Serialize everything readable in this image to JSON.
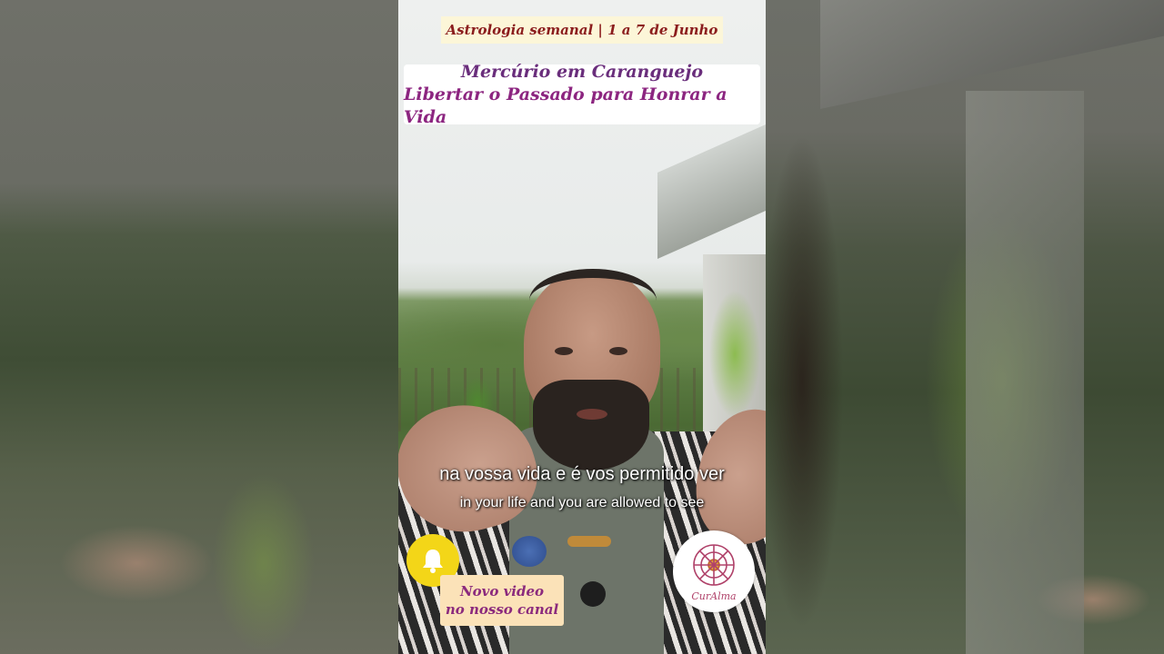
{
  "video": {
    "header_tag": "Astrologia semanal | 1 a 7 de Junho",
    "title_line1": "Mercúrio em Caranguejo",
    "title_line2": "Libertar o Passado para Honrar a Vida",
    "subtitle_original": "na vossa vida e é vos permitido ver",
    "subtitle_translation": "in your life and you are allowed to see",
    "promo_line1": "Novo video",
    "promo_line2": "no nosso canal",
    "logo_text": "CurAlma",
    "bell_icon": "bell-icon"
  },
  "colors": {
    "title_purple": "#6a2e7c",
    "header_red": "#8b1d1d",
    "bell_yellow": "#f3d618",
    "promo_bg": "#fbe2b8"
  }
}
